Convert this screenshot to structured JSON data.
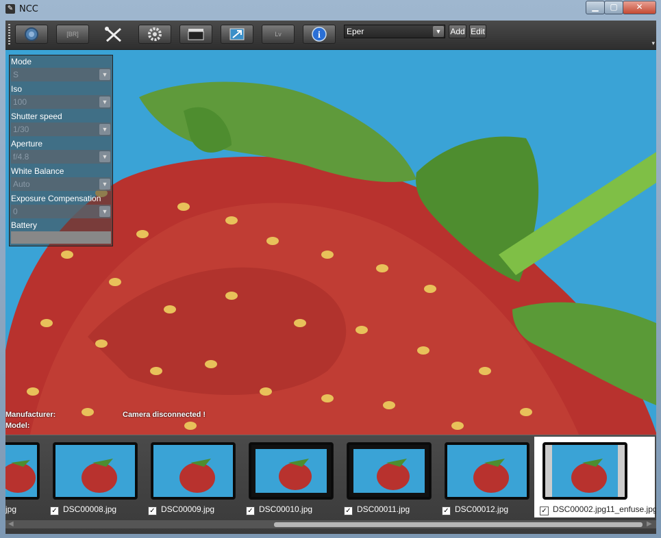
{
  "window": {
    "title": "NCC",
    "controls": {
      "minimize": "▁",
      "maximize": "▢",
      "close": "✕"
    }
  },
  "toolbar": {
    "buttons": [
      {
        "name": "capture-button",
        "icon": "lens-icon",
        "label": ""
      },
      {
        "name": "bracketing-button",
        "icon": "br-icon",
        "label": "[BR]"
      },
      {
        "name": "tools-button",
        "icon": "tools-icon",
        "label": ""
      },
      {
        "name": "settings-button",
        "icon": "gear-icon",
        "label": ""
      },
      {
        "name": "movie-button",
        "icon": "clapperboard-icon",
        "label": ""
      },
      {
        "name": "fullscreen-button",
        "icon": "expand-icon",
        "label": ""
      },
      {
        "name": "liveview-button",
        "icon": "lv-icon",
        "label": "Lv"
      },
      {
        "name": "about-button",
        "icon": "info-icon",
        "label": "i"
      }
    ],
    "profile_select": {
      "value": "Eper"
    },
    "add_label": "Add",
    "edit_label": "Edit"
  },
  "camera_panel": {
    "mode": {
      "label": "Mode",
      "value": "S"
    },
    "iso": {
      "label": "Iso",
      "value": "100"
    },
    "shutter": {
      "label": "Shutter speed",
      "value": "1/30"
    },
    "aperture": {
      "label": "Aperture",
      "value": "f/4.8"
    },
    "white_balance": {
      "label": "White Balance",
      "value": "Auto"
    },
    "exposure": {
      "label": "Exposure Compensation",
      "value": "0"
    },
    "battery": {
      "label": "Battery",
      "level": 0
    }
  },
  "info": {
    "manufacturer_label": "Manufacturer:",
    "model_label": "Model:",
    "status": "Camera disconnected !"
  },
  "thumbnails": [
    {
      "name": "jpg",
      "checked": false,
      "partial": true
    },
    {
      "name": "DSC00008.jpg",
      "checked": true
    },
    {
      "name": "DSC00009.jpg",
      "checked": true
    },
    {
      "name": "DSC00010.jpg",
      "checked": true
    },
    {
      "name": "DSC00011.jpg",
      "checked": true
    },
    {
      "name": "DSC00012.jpg",
      "checked": true
    },
    {
      "name": "DSC00002.jpg11_enfuse.jpg",
      "checked": true,
      "selected": true
    }
  ],
  "colors": {
    "sky": "#3aa3d6",
    "berry": "#b8322e",
    "leaf": "#4e8d2f"
  }
}
